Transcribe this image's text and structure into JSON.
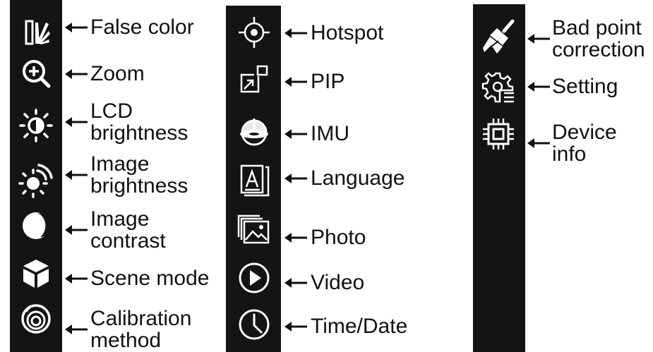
{
  "colors": {
    "strip": "#141414",
    "icon": "#ffffff",
    "text": "#111111"
  },
  "columns": [
    {
      "items": [
        {
          "icon": "false-color-icon",
          "lines": [
            "False color"
          ]
        },
        {
          "icon": "zoom-icon",
          "lines": [
            "Zoom"
          ]
        },
        {
          "icon": "lcd-brightness-icon",
          "lines": [
            "LCD",
            "brightness"
          ]
        },
        {
          "icon": "image-brightness-icon",
          "lines": [
            "Image",
            "brightness"
          ]
        },
        {
          "icon": "image-contrast-icon",
          "lines": [
            "Image",
            "contrast"
          ]
        },
        {
          "icon": "scene-mode-icon",
          "lines": [
            "Scene mode"
          ]
        },
        {
          "icon": "calibration-method-icon",
          "lines": [
            "Calibration",
            "method"
          ]
        }
      ]
    },
    {
      "items": [
        {
          "icon": "hotspot-icon",
          "lines": [
            "Hotspot"
          ]
        },
        {
          "icon": "pip-icon",
          "lines": [
            "PIP"
          ]
        },
        {
          "icon": "imu-icon",
          "lines": [
            "IMU"
          ]
        },
        {
          "icon": "language-icon",
          "lines": [
            "Language"
          ]
        },
        {
          "icon": "photo-icon",
          "lines": [
            "Photo"
          ]
        },
        {
          "icon": "video-icon",
          "lines": [
            "Video"
          ]
        },
        {
          "icon": "time-date-icon",
          "lines": [
            "Time/Date"
          ]
        }
      ]
    },
    {
      "items": [
        {
          "icon": "bad-point-correction-icon",
          "lines": [
            "Bad point",
            "correction"
          ]
        },
        {
          "icon": "setting-icon",
          "lines": [
            "Setting"
          ]
        },
        {
          "icon": "device-info-icon",
          "lines": [
            "Device",
            "info"
          ]
        }
      ]
    }
  ]
}
